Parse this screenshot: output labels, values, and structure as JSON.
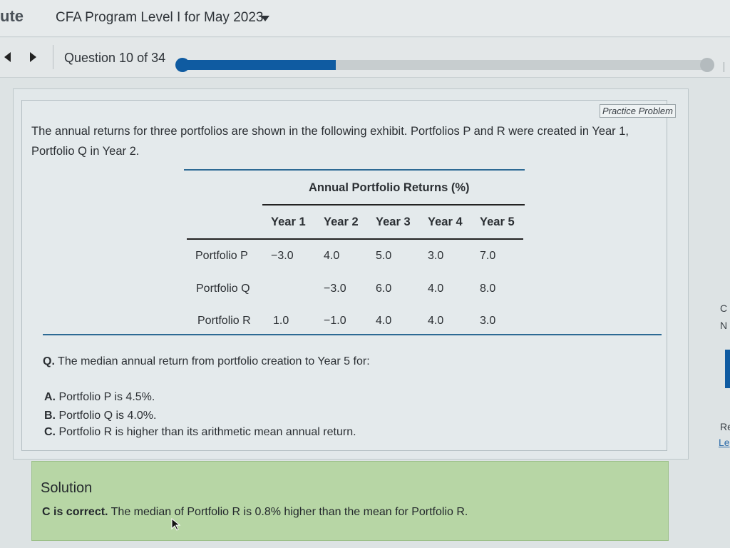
{
  "header": {
    "brand": "ute",
    "course_title": "CFA Program Level I for May 2023"
  },
  "nav": {
    "question_counter": "Question 10 of 34",
    "progress_fraction": 0.2941
  },
  "practice_label": "Practice Problem",
  "intro": "The annual returns for three portfolios are shown in the following exhibit. Portfolios P and R were created in Year 1, Portfolio Q in Year 2.",
  "table": {
    "title": "Annual Portfolio Returns (%)",
    "columns": [
      "Year 1",
      "Year 2",
      "Year 3",
      "Year 4",
      "Year 5"
    ],
    "rows": [
      {
        "label": "Portfolio P",
        "values": [
          "−3.0",
          "4.0",
          "5.0",
          "3.0",
          "7.0"
        ]
      },
      {
        "label": "Portfolio Q",
        "values": [
          "",
          "−3.0",
          "6.0",
          "4.0",
          "8.0"
        ]
      },
      {
        "label": "Portfolio R",
        "values": [
          "1.0",
          "−1.0",
          "4.0",
          "4.0",
          "3.0"
        ]
      }
    ]
  },
  "question": {
    "marker": "Q.",
    "text": "The median annual return from portfolio creation to Year 5 for:"
  },
  "options": [
    {
      "letter": "A.",
      "text": "Portfolio P is 4.5%."
    },
    {
      "letter": "B.",
      "text": "Portfolio Q is 4.0%."
    },
    {
      "letter": "C.",
      "text": "Portfolio R is higher than its arithmetic mean annual return."
    }
  ],
  "solution": {
    "heading": "Solution",
    "bold": "C is correct.",
    "text": " The median of Portfolio R is 0.8% higher than the mean for Portfolio R."
  },
  "edge": {
    "text_1": "C",
    "text_2": "N",
    "text_3": "Re",
    "link": "Le"
  },
  "colors": {
    "accent": "#0f5ba1",
    "solution_bg": "#b7d6a5",
    "rule_blue": "#2d6a94"
  }
}
